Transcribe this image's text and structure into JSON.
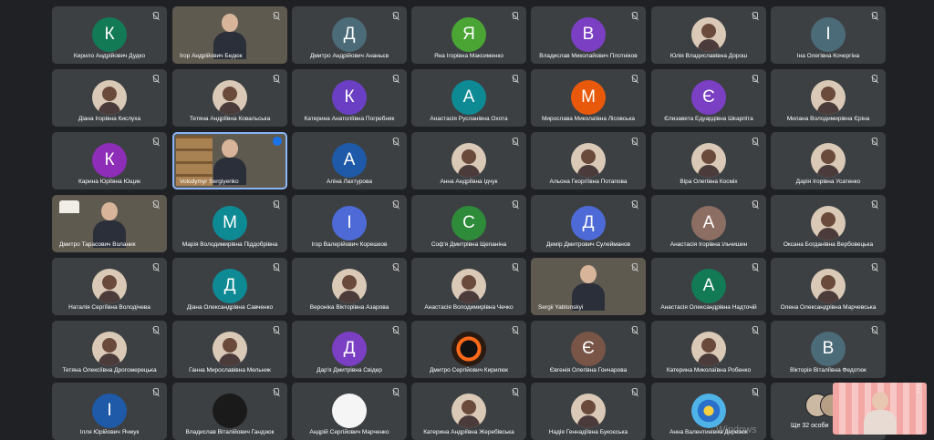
{
  "colors": {
    "background": "#202124",
    "tile": "#3c4043",
    "speaking": "#1a73e8"
  },
  "participants": [
    {
      "name": "Кирило Андрійович Дудко",
      "initial": "К",
      "color": "#137a56"
    },
    {
      "name": "Ігор Андрійович Бедюк",
      "video": true
    },
    {
      "name": "Дмитро Андрійович Ананьєв",
      "initial": "Д",
      "color": "#4c6b78"
    },
    {
      "name": "Яна Ігорівна Максименко",
      "initial": "Я",
      "color": "#4aa534"
    },
    {
      "name": "Владислав Миколайович Плотніков",
      "initial": "В",
      "color": "#7b3fc4"
    },
    {
      "name": "Юлія Владиславівна Дорош",
      "photo": true
    },
    {
      "name": "Іна Олегівна Кочергіна",
      "initial": "І",
      "color": "#4c6b78"
    },
    {
      "name": "Діана Ігорівна Кислуха",
      "photo": true
    },
    {
      "name": "Тетяна Андріївна Ковальська",
      "photo": true
    },
    {
      "name": "Катерина Анатоліївна Погребняк",
      "initial": "К",
      "color": "#6b3fc4"
    },
    {
      "name": "Анастасія Русланівна Охота",
      "initial": "А",
      "color": "#0e8a94"
    },
    {
      "name": "Мирослава Миколаївна Лісовська",
      "initial": "М",
      "color": "#e8590c"
    },
    {
      "name": "Єлизавета Едуардівна Шкарпіта",
      "initial": "Є",
      "color": "#7b3fc4"
    },
    {
      "name": "Милана Володимирівна Єріна",
      "photo": true
    },
    {
      "name": "Карина Юріївна Ющик",
      "initial": "К",
      "color": "#8e2db8"
    },
    {
      "name": "Volodymyr Sergiyenko",
      "video": true,
      "shelf": true,
      "speaking": true
    },
    {
      "name": "Аліна Лахтурова",
      "initial": "А",
      "color": "#1e5aa8"
    },
    {
      "name": "Анна Андріївна Ідчук",
      "photo": true
    },
    {
      "name": "Альона Георгіївна Потапова",
      "photo": true
    },
    {
      "name": "Віра Олегівна Косміх",
      "photo": true
    },
    {
      "name": "Дарія Ігорівна Усатенко",
      "photo": true
    },
    {
      "name": "Дмитро Тарасович Воланик",
      "video": true,
      "lamp": true
    },
    {
      "name": "Марія Володимирівна Піддобрівна",
      "initial": "М",
      "color": "#0e8a94"
    },
    {
      "name": "Ігор Валерійович Корешков",
      "initial": "І",
      "color": "#4d6ad6"
    },
    {
      "name": "Соф'я Дмитрівна Щепаніна",
      "initial": "С",
      "color": "#2e8b3a"
    },
    {
      "name": "Демір Дмитрович Сулейманов",
      "initial": "Д",
      "color": "#4d6ad6"
    },
    {
      "name": "Анастасія Ігорівна Ільчишин",
      "initial": "А",
      "color": "#8d6e63"
    },
    {
      "name": "Оксана Богданівна Вербовецька",
      "photo": true
    },
    {
      "name": "Наталія Сергіївна Володічева",
      "photo": true
    },
    {
      "name": "Діана Олександрівна Савченко",
      "initial": "Д",
      "color": "#0e8a94"
    },
    {
      "name": "Вероніка Вікторівна Азарова",
      "photo": true
    },
    {
      "name": "Анастасія Володимирівна Чечко",
      "photo": true
    },
    {
      "name": "Sergii Yablonskyi",
      "video": true
    },
    {
      "name": "Анастасія Олександрівна Надточій",
      "initial": "А",
      "color": "#137a56"
    },
    {
      "name": "Олена Олександрівна Марчевська",
      "photo": true
    },
    {
      "name": "Тетяна Олексіївна Дрогомерецька",
      "photo": true
    },
    {
      "name": "Ганна Мирославівна Мельник",
      "photo": true
    },
    {
      "name": "Дар'я Дмитрівна Свідер",
      "initial": "Д",
      "color": "#7b3fc4"
    },
    {
      "name": "Дмитро Сергійович Кирилюк",
      "planet": true
    },
    {
      "name": "Євгенія Олегівна Гончарова",
      "initial": "Є",
      "color": "#795548"
    },
    {
      "name": "Катерина Миколаївна Робенко",
      "photo": true
    },
    {
      "name": "Вікторія Віталіївна Федотюк",
      "initial": "В",
      "color": "#4c6b78"
    },
    {
      "name": "Ілля Юрійович Ячмук",
      "initial": "І",
      "color": "#1e5aa8"
    },
    {
      "name": "Владислав Віталійович Гандзюк",
      "dark": true
    },
    {
      "name": "Андрій Сергійович Марченко",
      "white": true
    },
    {
      "name": "Катерина Андріївна Жеребівська",
      "photo": true
    },
    {
      "name": "Надія Геннадіївна Букоєська",
      "photo": true
    },
    {
      "name": "Анна Валентинівна Дерезюк",
      "mandala": true
    }
  ],
  "more": {
    "label": "Ще 32 особи"
  },
  "self_view": {
    "more_icon": "more-vert-icon"
  },
  "watermark": "Windows"
}
